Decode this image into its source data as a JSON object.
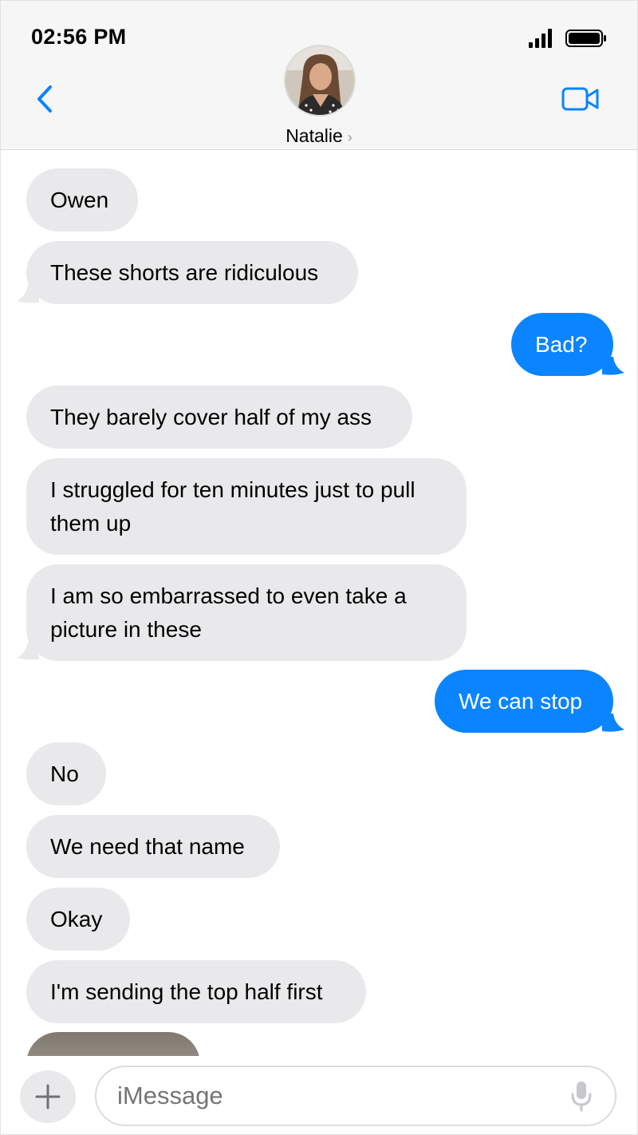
{
  "status_bar": {
    "time": "02:56 PM"
  },
  "header": {
    "contact_name": "Natalie",
    "chevron": "›"
  },
  "messages": [
    {
      "direction": "in",
      "text": "Owen"
    },
    {
      "direction": "in",
      "text": "These shorts are ridiculous"
    },
    {
      "direction": "out",
      "text": "Bad?"
    },
    {
      "direction": "in",
      "text": "They barely cover half of my ass"
    },
    {
      "direction": "in",
      "text": "I struggled for ten minutes just to pull them up"
    },
    {
      "direction": "in",
      "text": "I am so embarrassed to even take a picture in these"
    },
    {
      "direction": "out",
      "text": "We can stop"
    },
    {
      "direction": "in",
      "text": "No"
    },
    {
      "direction": "in",
      "text": "We need that name"
    },
    {
      "direction": "in",
      "text": "Okay"
    },
    {
      "direction": "in",
      "text": "I'm sending the top half first"
    }
  ],
  "composer": {
    "placeholder": "iMessage"
  },
  "icons": {
    "back": "chevron-left-icon",
    "video": "video-camera-icon",
    "plus": "plus-icon",
    "mic": "microphone-icon",
    "signal": "cellular-signal-icon",
    "battery": "battery-icon"
  },
  "colors": {
    "accent": "#0b84ff",
    "incoming_bubble": "#e9e9eb",
    "header_bg": "#f6f6f6"
  }
}
